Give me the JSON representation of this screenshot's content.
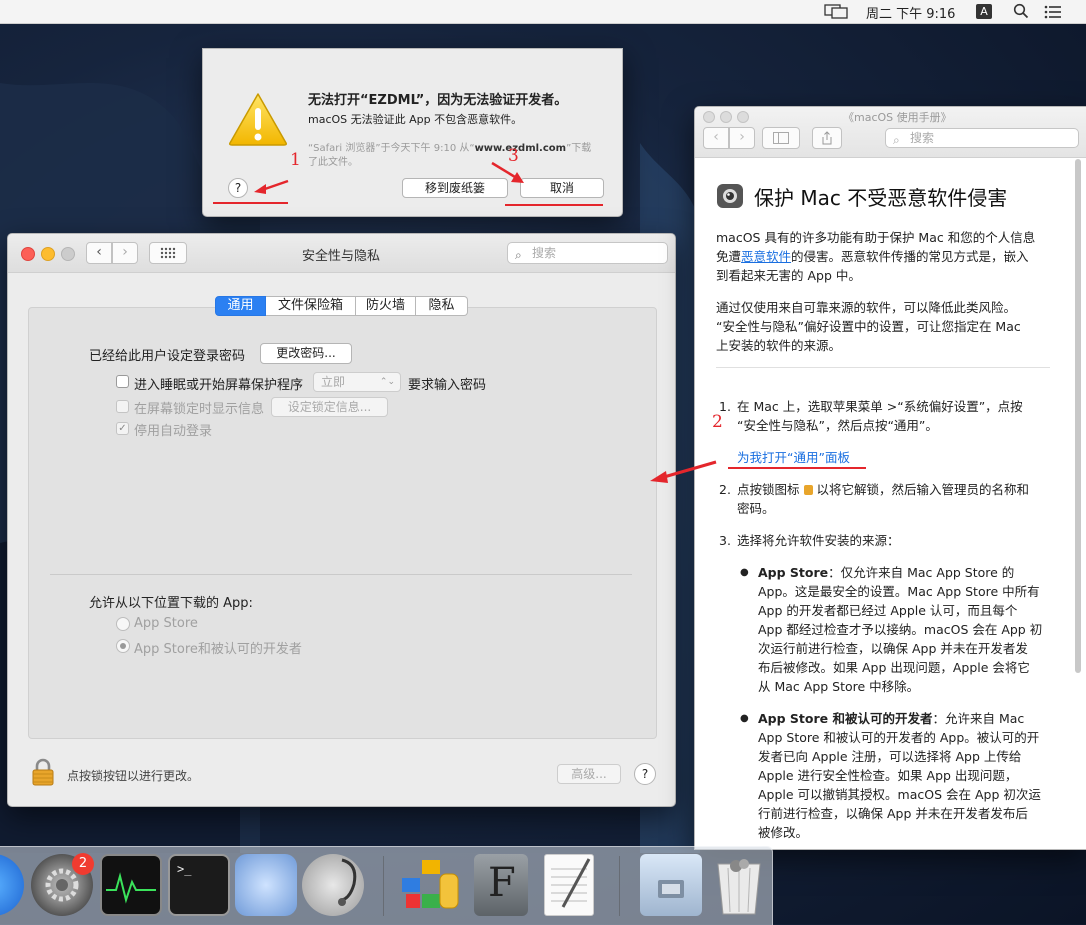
{
  "menubar": {
    "clock": "周二 下午 9:16",
    "input_method": "A"
  },
  "alert": {
    "title": "无法打开“EZDML”，因为无法验证开发者。",
    "message": "macOS 无法验证此 App 不包含恶意软件。",
    "source_prefix": "“Safari 浏览器”于今天下午 9:10 从“",
    "source_domain": "www.ezdml.com",
    "source_suffix": "”下载",
    "source_line2": "了此文件。",
    "help_label": "?",
    "trash_button": "移到废纸篓",
    "cancel_button": "取消"
  },
  "annotations": {
    "mark1": "1",
    "mark2": "2",
    "mark3": "3"
  },
  "prefs": {
    "title": "安全性与隐私",
    "search_placeholder": "搜索",
    "tabs": [
      "通用",
      "文件保险箱",
      "防火墙",
      "隐私"
    ],
    "password_label": "已经给此用户设定登录密码",
    "change_password_button": "更改密码...",
    "sleep_checkbox_label": "进入睡眠或开始屏幕保护程序",
    "sleep_select_value": "立即",
    "require_password_label": "要求输入密码",
    "lock_message_label": "在屏幕锁定时显示信息",
    "lock_message_button": "设定锁定信息...",
    "auto_login_label": "停用自动登录",
    "allow_apps_title": "允许从以下位置下载的 App:",
    "option_app_store": "App Store",
    "option_identified": "App Store和被认可的开发者",
    "lock_text": "点按锁按钮以进行更改。",
    "advanced_button": "高级...",
    "help_label": "?"
  },
  "help": {
    "window_title": "《macOS 使用手册》",
    "search_placeholder": "搜索",
    "heading": "保护 Mac 不受恶意软件侵害",
    "intro_1": "macOS 具有的许多功能有助于保护 Mac 和您的个人信息",
    "intro_2a": "免遭",
    "intro_2_link": "恶意软件",
    "intro_2b": "的侵害。恶意软件传播的常见方式是，嵌入",
    "intro_3": "到看起来无害的 App 中。",
    "para2_1": "通过仅使用来自可靠来源的软件，可以降低此类风险。",
    "para2_2": "“安全性与隐私”偏好设置中的设置，可让您指定在 Mac",
    "para2_3": "上安装的软件的来源。",
    "step1_num": "1.",
    "step1_1a": "在 Mac 上，选取苹果菜单",
    "step1_1b": ">“系统偏好设置”，点按",
    "step1_2": "“安全性与隐私”，然后点按“通用”。",
    "open_general_link": "为我打开“通用”面板",
    "step2_num": "2.",
    "step2_1": "点按锁图标",
    "step2_1b": "以将它解锁，然后输入管理员的名称和",
    "step2_2": "密码。",
    "step3_num": "3.",
    "step3_1": "选择将允许软件安装的来源：",
    "b1_bold": "App Store",
    "b1_1": "：仅允许来自 Mac App Store 的",
    "b1_2": "App。这是最安全的设置。Mac App Store 中所有",
    "b1_3": "App 的开发者都已经过 Apple 认可，而且每个",
    "b1_4": "App 都经过检查才予以接纳。macOS 会在 App 初",
    "b1_5": "次运行前进行检查，以确保 App 并未在开发者发",
    "b1_6": "布后被修改。如果 App 出现问题，Apple 会将它",
    "b1_7": "从 Mac App Store 中移除。",
    "b2_bold": "App Store 和被认可的开发者",
    "b2_1": "：允许来自 Mac",
    "b2_2": "App Store 和被认可的开发者的 App。被认可的开",
    "b2_3": "发者已向 Apple 注册，可以选择将 App 上传给",
    "b2_4": "Apple 进行安全性检查。如果 App 出现问题，",
    "b2_5": "Apple 可以撤销其授权。macOS 会在 App 初次运",
    "b2_6": "行前进行检查，以确保 App 并未在开发者发布后",
    "b2_7": "被修改。"
  },
  "dock": {
    "badge": "2",
    "terminal_prompt": ">_",
    "font_book_letter": "F"
  }
}
